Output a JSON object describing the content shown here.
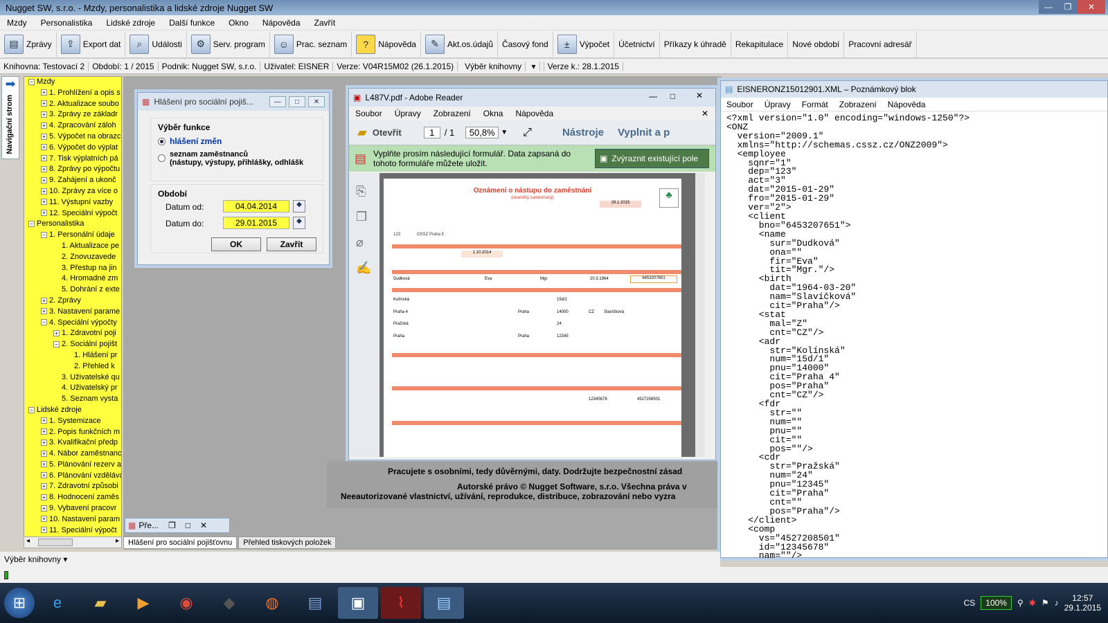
{
  "app": {
    "title": "Nugget SW, s.r.o. - Mzdy, personalistika a lidské zdroje Nugget SW"
  },
  "menu": [
    "Mzdy",
    "Personalistika",
    "Lidské zdroje",
    "Další funkce",
    "Okno",
    "Nápověda",
    "Zavřít"
  ],
  "toolbar": [
    {
      "label": "Zprávy",
      "icon": "printer-icon"
    },
    {
      "label": "Export dat",
      "icon": "export-icon"
    },
    {
      "label": "Události",
      "icon": "magnifier-icon"
    },
    {
      "label": "Serv. program",
      "icon": "gear-icon"
    },
    {
      "label": "Prac. seznam",
      "icon": "person-icon"
    },
    {
      "label": "Nápověda",
      "icon": "help-icon"
    },
    {
      "label": "Akt.os.údajů",
      "icon": "edit-icon"
    },
    {
      "label": "Časový fond",
      "icon": ""
    },
    {
      "label": "Výpočet",
      "icon": "calculator-icon"
    },
    {
      "label": "Účetnictví",
      "icon": ""
    },
    {
      "label": "Příkazy k úhradě",
      "icon": ""
    },
    {
      "label": "Rekapitulace",
      "icon": ""
    },
    {
      "label": "Nové období",
      "icon": ""
    },
    {
      "label": "Pracovní adresář",
      "icon": ""
    }
  ],
  "status": {
    "knihovna": "Knihovna: Testovací 2",
    "obdobi": "Období: 1 / 2015",
    "podnik": "Podnik: Nugget SW, s.r.o.",
    "uzivatel": "Uživatel: EISNER",
    "verze": "Verze: V04R15M02 (26.1.2015)",
    "vyber": "Výběr knihovny",
    "verzek": "Verze k.: 28.1.2015"
  },
  "navtab": "Navigační strom",
  "tree": [
    {
      "l": 0,
      "t": "Mzdy",
      "pm": "−"
    },
    {
      "l": 1,
      "t": "1. Prohlížení a opis s",
      "pm": "+"
    },
    {
      "l": 1,
      "t": "2. Aktualizace soubo",
      "pm": "+"
    },
    {
      "l": 1,
      "t": "3. Zprávy ze základr",
      "pm": "+"
    },
    {
      "l": 1,
      "t": "4. Zpracování záloh",
      "pm": "+"
    },
    {
      "l": 1,
      "t": "5. Výpočet na obrazc",
      "pm": "+"
    },
    {
      "l": 1,
      "t": "6. Výpočet do výplat",
      "pm": "+"
    },
    {
      "l": 1,
      "t": "7. Tisk výplatních pá",
      "pm": "+"
    },
    {
      "l": 1,
      "t": "8. Zprávy po výpočtu",
      "pm": "+"
    },
    {
      "l": 1,
      "t": "9. Zahájení a ukonč",
      "pm": "+"
    },
    {
      "l": 1,
      "t": "10. Zprávy za více o",
      "pm": "+"
    },
    {
      "l": 1,
      "t": "11. Výstupní vazby",
      "pm": "+"
    },
    {
      "l": 1,
      "t": "12. Speciální výpočt",
      "pm": "+"
    },
    {
      "l": 0,
      "t": "Personalistika",
      "pm": "−"
    },
    {
      "l": 1,
      "t": "1. Personální údaje",
      "pm": "−"
    },
    {
      "l": 2,
      "t": "1. Aktualizace pe",
      "pm": ""
    },
    {
      "l": 2,
      "t": "2. Znovuzavede",
      "pm": ""
    },
    {
      "l": 2,
      "t": "3. Přestup na jin",
      "pm": ""
    },
    {
      "l": 2,
      "t": "4. Hromadné zm",
      "pm": ""
    },
    {
      "l": 2,
      "t": "5. Dohrání z exte",
      "pm": ""
    },
    {
      "l": 1,
      "t": "2. Zprávy",
      "pm": "+"
    },
    {
      "l": 1,
      "t": "3. Nastavení parame",
      "pm": "+"
    },
    {
      "l": 1,
      "t": "4. Speciální výpočty",
      "pm": "−"
    },
    {
      "l": 2,
      "t": "1. Zdravotní poji",
      "pm": "+"
    },
    {
      "l": 2,
      "t": "2. Sociální pojišt",
      "pm": "−"
    },
    {
      "l": 3,
      "t": "1. Hlášení pr",
      "pm": ""
    },
    {
      "l": 3,
      "t": "2. Přehled k",
      "pm": ""
    },
    {
      "l": 2,
      "t": "3. Uživatelské qu",
      "pm": ""
    },
    {
      "l": 2,
      "t": "4. Uživatelský pr",
      "pm": ""
    },
    {
      "l": 2,
      "t": "5. Seznam vysta",
      "pm": ""
    },
    {
      "l": 0,
      "t": "Lidské zdroje",
      "pm": "−"
    },
    {
      "l": 1,
      "t": "1. Systemizace",
      "pm": "+"
    },
    {
      "l": 1,
      "t": "2. Popis funkčních m",
      "pm": "+"
    },
    {
      "l": 1,
      "t": "3. Kvalifikační předp",
      "pm": "+"
    },
    {
      "l": 1,
      "t": "4. Nábor zaměstnanc",
      "pm": "+"
    },
    {
      "l": 1,
      "t": "5. Plánování rezerv a",
      "pm": "+"
    },
    {
      "l": 1,
      "t": "6. Plánování vzdělává",
      "pm": "+"
    },
    {
      "l": 1,
      "t": "7. Zdravotní způsobi",
      "pm": "+"
    },
    {
      "l": 1,
      "t": "8. Hodnocení zaměs",
      "pm": "+"
    },
    {
      "l": 1,
      "t": "9. Vybavení pracovr",
      "pm": "+"
    },
    {
      "l": 1,
      "t": "10. Nastavení param",
      "pm": "+"
    },
    {
      "l": 1,
      "t": "11. Speciální výpočt",
      "pm": "+"
    }
  ],
  "dialog": {
    "title": "Hlášení pro sociální pojiš...",
    "group1": "Výběr funkce",
    "opt1": "hlášení změn",
    "opt2a": "seznam zaměstnanců",
    "opt2b": "(nástupy, výstupy, přihlášky, odhlášk",
    "group2": "Období",
    "od_label": "Datum od:",
    "od_value": "04.04.2014",
    "do_label": "Datum do:",
    "do_value": "29.01.2015",
    "ok": "OK",
    "close": "Zavřít"
  },
  "reader": {
    "title": "L487V.pdf - Adobe Reader",
    "menu": [
      "Soubor",
      "Úpravy",
      "Zobrazení",
      "Okna",
      "Nápověda"
    ],
    "open": "Otevřít",
    "page": "1",
    "pages": "/ 1",
    "zoom": "50,8%",
    "tools": "Nástroje",
    "fill": "Vyplnit a p",
    "notice": "Vyplňte prosím následující formulář. Data zapsaná do tohoto formuláře můžete uložit.",
    "highlight": "Zvýraznit existující pole",
    "form_title": "Oznámení o nástupu do zaměstnání",
    "form_sub": "(okamžitý zaměstnaný)",
    "f_date1": "1.10.2014",
    "f_date2": "29.1.2015",
    "f_surname": "Dudková",
    "f_first": "Eva",
    "f_tit": "Mgr.",
    "f_birth": "20.3.1964",
    "f_bno": "6453207651",
    "f_street": "Kolínská",
    "f_num": "15d/1",
    "f_city": "Praha 4",
    "f_pos": "Praha",
    "f_psc": "14000",
    "f_cz": "CZ",
    "f_maiden": "Slavíčková",
    "f_street2": "Pražská",
    "f_num2": "24",
    "f_city2": "Praha",
    "f_psc2": "12345",
    "f_id": "12345678",
    "f_vs": "4527208501",
    "f_ossz": "OSSZ Praha 5",
    "f_code": "123"
  },
  "notepad": {
    "title": "EISNERONZ15012901.XML – Poznámkový blok",
    "menu": [
      "Soubor",
      "Úpravy",
      "Formát",
      "Zobrazení",
      "Nápověda"
    ],
    "lines": [
      "<?xml version=\"1.0\" encoding=\"windows-1250\"?>",
      "<ONZ",
      "  version=\"2009.1\"",
      "  xmlns=\"http://schemas.cssz.cz/ONZ2009\">",
      "  <employee",
      "    sqnr=\"1\"",
      "    dep=\"123\"",
      "    act=\"3\"",
      "    dat=\"2015-01-29\"",
      "    fro=\"2015-01-29\"",
      "    ver=\"2\">",
      "    <client",
      "      bno=\"6453207651\">",
      "      <name",
      "        sur=\"Dudková\"",
      "        ona=\"\"",
      "        fir=\"Eva\"",
      "        tit=\"Mgr.\"/>",
      "      <birth",
      "        dat=\"1964-03-20\"",
      "        nam=\"Slavíčková\"",
      "        cit=\"Praha\"/>",
      "      <stat",
      "        mal=\"Z\"",
      "        cnt=\"CZ\"/>",
      "      <adr",
      "        str=\"Kolínská\"",
      "        num=\"15d/1\"",
      "        pnu=\"14000\"",
      "        cit=\"Praha 4\"",
      "        pos=\"Praha\"",
      "        cnt=\"CZ\"/>",
      "      <fdr",
      "        str=\"\"",
      "        num=\"\"",
      "        pnu=\"\"",
      "        cit=\"\"",
      "        pos=\"\"/>",
      "      <cdr",
      "        str=\"Pražská\"",
      "        num=\"24\"",
      "        pnu=\"12345\"",
      "        cit=\"Praha\"",
      "        cnt=\"\"",
      "        pos=\"Praha\"/>",
      "    </client>",
      "    <comp",
      "      vs=\"4527208501\"",
      "      id=\"12345678\"",
      "      nam=\"\"/>"
    ]
  },
  "copyright": {
    "l1": "Pracujete s osobními, tedy důvěrnými, daty. Dodržujte bezpečnostní zásad",
    "l2": "Autorské právo © Nugget Software, s.r.o. Všechna práva v",
    "l3": "Neeautorizované vlastnictví, užívání, reprodukce, distribuce, zobrazování nebo vyzra"
  },
  "mini": {
    "label": "Pře..."
  },
  "tabs": [
    "Hlášení pro sociální pojišťovnu",
    "Přehled tiskových položek"
  ],
  "bottom": {
    "vyber": "Výběr knihovny"
  },
  "tray": {
    "lang": "CS",
    "battery": "100%",
    "time": "12:57",
    "date": "29.1.2015"
  }
}
